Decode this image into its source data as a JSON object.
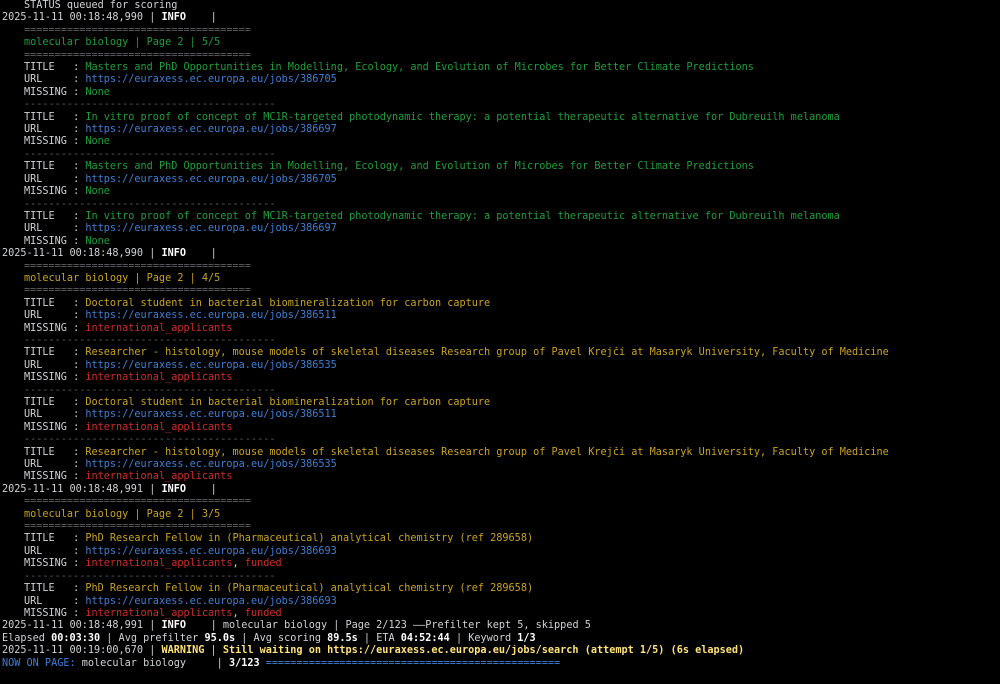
{
  "status_line": "STATUS queued for scoring",
  "blocks": [
    {
      "timestamp": "2025-11-11 00:18:48,990",
      "level": "INFO",
      "eq_sep": "=====================================",
      "dash_sep": "-----------------------------------------",
      "header": "molecular biology | Page 2 | 5/5",
      "color": "green",
      "entries": [
        {
          "title": "Masters and PhD Opportunities in Modelling, Ecology, and Evolution of Microbes for Better Climate Predictions",
          "url": "https://euraxess.ec.europa.eu/jobs/386705",
          "missing": [
            {
              "t": "None",
              "c": "green"
            }
          ]
        },
        {
          "title": "In vitro proof of concept of MC1R-targeted photodynamic therapy: a potential therapeutic alternative for Dubreuilh melanoma",
          "url": "https://euraxess.ec.europa.eu/jobs/386697",
          "missing": [
            {
              "t": "None",
              "c": "green"
            }
          ]
        },
        {
          "title": "Masters and PhD Opportunities in Modelling, Ecology, and Evolution of Microbes for Better Climate Predictions",
          "url": "https://euraxess.ec.europa.eu/jobs/386705",
          "missing": [
            {
              "t": "None",
              "c": "green"
            }
          ]
        },
        {
          "title": "In vitro proof of concept of MC1R-targeted photodynamic therapy: a potential therapeutic alternative for Dubreuilh melanoma",
          "url": "https://euraxess.ec.europa.eu/jobs/386697",
          "missing": [
            {
              "t": "None",
              "c": "green"
            }
          ]
        }
      ]
    },
    {
      "timestamp": "2025-11-11 00:18:48,990",
      "level": "INFO",
      "eq_sep": "=====================================",
      "dash_sep": "-----------------------------------------",
      "header": "molecular biology | Page 2 | 4/5",
      "color": "gold",
      "entries": [
        {
          "title": "Doctoral student in bacterial biomineralization for carbon capture",
          "url": "https://euraxess.ec.europa.eu/jobs/386511",
          "missing": [
            {
              "t": "international_applicants",
              "c": "red"
            }
          ]
        },
        {
          "title": "Researcher - histology, mouse models of skeletal diseases Research group of Pavel Krejčí at Masaryk University, Faculty of Medicine",
          "url": "https://euraxess.ec.europa.eu/jobs/386535",
          "missing": [
            {
              "t": "international_applicants",
              "c": "red"
            }
          ]
        },
        {
          "title": "Doctoral student in bacterial biomineralization for carbon capture",
          "url": "https://euraxess.ec.europa.eu/jobs/386511",
          "missing": [
            {
              "t": "international_applicants",
              "c": "red"
            }
          ]
        },
        {
          "title": "Researcher - histology, mouse models of skeletal diseases Research group of Pavel Krejčí at Masaryk University, Faculty of Medicine",
          "url": "https://euraxess.ec.europa.eu/jobs/386535",
          "missing": [
            {
              "t": "international_applicants",
              "c": "red"
            }
          ]
        }
      ]
    },
    {
      "timestamp": "2025-11-11 00:18:48,991",
      "level": "INFO",
      "eq_sep": "=====================================",
      "dash_sep": "-----------------------------------------",
      "header": "molecular biology | Page 2 | 3/5",
      "color": "gold",
      "entries": [
        {
          "title": "PhD Research Fellow in (Pharmaceutical) analytical chemistry (ref 289658)",
          "url": "https://euraxess.ec.europa.eu/jobs/386693",
          "missing": [
            {
              "t": "international_applicants",
              "c": "red"
            },
            {
              "t": ", ",
              "c": "k"
            },
            {
              "t": "funded",
              "c": "red"
            }
          ]
        },
        {
          "title": "PhD Research Fellow in (Pharmaceutical) analytical chemistry (ref 289658)",
          "url": "https://euraxess.ec.europa.eu/jobs/386693",
          "missing": [
            {
              "t": "international_applicants",
              "c": "red"
            },
            {
              "t": ", ",
              "c": "k"
            },
            {
              "t": "funded",
              "c": "red"
            }
          ]
        }
      ]
    }
  ],
  "labels": {
    "title": "TITLE   : ",
    "url": "URL     : ",
    "missing": "MISSING : "
  },
  "summary": {
    "timestamp": "2025-11-11 00:18:48,991",
    "level": "INFO",
    "message": "molecular biology | Page 2/123 ——Prefilter kept 5, skipped 5"
  },
  "elapsed": {
    "label_elapsed": "Elapsed ",
    "elapsed": "00:03:30",
    "label_prefilter": " | Avg prefilter ",
    "prefilter": "95.0s",
    "label_scoring": " | Avg scoring ",
    "scoring": "89.5s",
    "label_eta": " | ETA ",
    "eta": "04:52:44",
    "label_keyword": " | Keyword ",
    "keyword": "1/3"
  },
  "warning": {
    "timestamp": "2025-11-11 00:19:00,670",
    "level": "WARNING",
    "message": "Still waiting on https://euraxess.ec.europa.eu/jobs/search (attempt 1/5) (6s elapsed)"
  },
  "now_on_page": {
    "label": "NOW ON PAGE: ",
    "keyword": "molecular biology",
    "progress": "3/123",
    "bar": "================================================"
  },
  "colors": {
    "background": "#000000",
    "green": "#1f9e3a",
    "gold": "#c9a227",
    "red": "#d22b2b",
    "url": "#3f7fd6"
  }
}
